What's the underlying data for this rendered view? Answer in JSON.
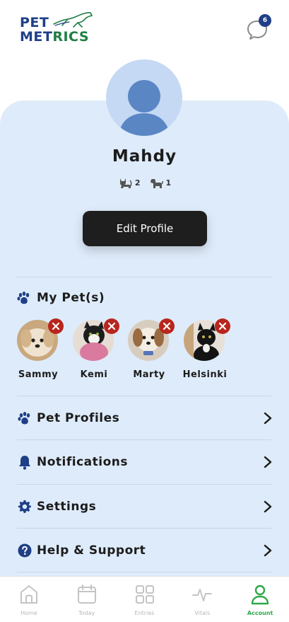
{
  "app": {
    "logo_line1": "PET",
    "logo_line2_part1": "MET",
    "logo_line2_part2": "RICS",
    "brand_colors": {
      "navy": "#1f3f86",
      "green": "#1e7e44"
    }
  },
  "header": {
    "chat_icon": "chat-bubble-icon",
    "chat_badge": "6"
  },
  "profile": {
    "avatar_icon": "user-silhouette-icon",
    "name": "Mahdy",
    "cat_count": "2",
    "dog_count": "1",
    "edit_button": "Edit Profile"
  },
  "my_pets": {
    "title": "My Pet(s)",
    "remove_icon": "close-icon",
    "pets": [
      {
        "name": "Sammy"
      },
      {
        "name": "Kemi"
      },
      {
        "name": "Marty"
      },
      {
        "name": "Helsinki"
      }
    ]
  },
  "menu": [
    {
      "label": "Pet Profiles",
      "icon": "paw-icon"
    },
    {
      "label": "Notifications",
      "icon": "bell-icon"
    },
    {
      "label": "Settings",
      "icon": "gear-icon"
    },
    {
      "label": "Help & Support",
      "icon": "help-icon"
    }
  ],
  "bottom_nav": [
    {
      "label": "Home",
      "icon": "home-icon",
      "active": false
    },
    {
      "label": "Today",
      "icon": "calendar-icon",
      "active": false
    },
    {
      "label": "Entries",
      "icon": "grid-icon",
      "active": false
    },
    {
      "label": "Vitals",
      "icon": "pulse-icon",
      "active": false
    },
    {
      "label": "Account",
      "icon": "user-icon",
      "active": true
    }
  ],
  "colors": {
    "panel_bg": "#deebfa",
    "accent_navy": "#1f3f86",
    "remove_red": "#b8261d",
    "nav_active_green": "#2ea84a"
  }
}
